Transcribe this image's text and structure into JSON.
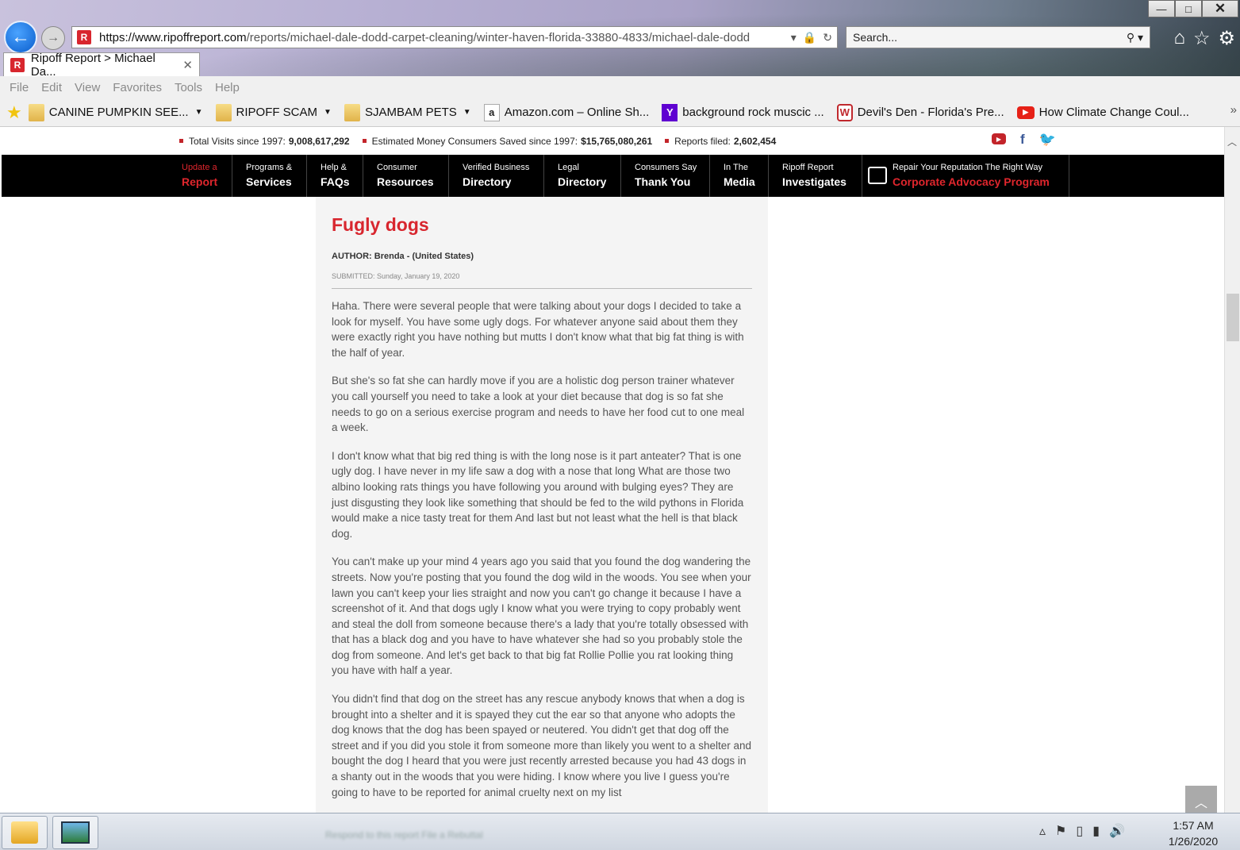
{
  "browser": {
    "url_host": "https://www.ripoffreport.com",
    "url_path": "/reports/michael-dale-dodd-carpet-cleaning/winter-haven-florida-33880-4833/michael-dale-dodd",
    "search_placeholder": "Search...",
    "tab_title": "Ripoff Report > Michael Da...",
    "window_buttons": {
      "minimize": "—",
      "maximize": "□",
      "close": "✕"
    }
  },
  "menu": [
    "File",
    "Edit",
    "View",
    "Favorites",
    "Tools",
    "Help"
  ],
  "favorites": [
    {
      "label": "CANINE PUMPKIN SEE...",
      "icon": "folder-icon",
      "dropdown": true
    },
    {
      "label": "RIPOFF SCAM",
      "icon": "folder-icon",
      "dropdown": true
    },
    {
      "label": "SJAMBAM PETS",
      "icon": "folder-icon",
      "dropdown": true
    },
    {
      "label": "Amazon.com – Online Sh...",
      "icon": "amazon-icon",
      "dropdown": false
    },
    {
      "label": "background rock muscic ...",
      "icon": "yahoo-icon",
      "dropdown": false
    },
    {
      "label": "Devil's Den - Florida's Pre...",
      "icon": "devils-den-icon",
      "dropdown": false
    },
    {
      "label": "How Climate Change Coul...",
      "icon": "youtube-icon",
      "dropdown": false
    }
  ],
  "stats": [
    {
      "label": "Total Visits since 1997:",
      "value": "9,008,617,292"
    },
    {
      "label": "Estimated Money Consumers Saved since 1997:",
      "value": "$15,765,080,261"
    },
    {
      "label": "Reports filed:",
      "value": "2,602,454"
    }
  ],
  "nav": [
    {
      "small": "Update a",
      "big": "Report",
      "red": true
    },
    {
      "small": "Programs &",
      "big": "Services",
      "red": false
    },
    {
      "small": "Help &",
      "big": "FAQs",
      "red": false
    },
    {
      "small": "Consumer",
      "big": "Resources",
      "red": false
    },
    {
      "small": "Verified Business",
      "big": "Directory",
      "red": false
    },
    {
      "small": "Legal",
      "big": "Directory",
      "red": false
    },
    {
      "small": "Consumers Say",
      "big": "Thank You",
      "red": false
    },
    {
      "small": "In The",
      "big": "Media",
      "red": false
    },
    {
      "small": "Ripoff Report",
      "big": "Investigates",
      "red": false
    },
    {
      "small": "Repair Your Reputation The Right Way",
      "big": "Corporate Advocacy Program",
      "red": true
    }
  ],
  "article": {
    "title": "Fugly dogs",
    "author": "AUTHOR: Brenda - (United States)",
    "submitted": "SUBMITTED: Sunday, January 19, 2020",
    "paragraphs": [
      " Haha. There were several people that were talking about your dogs I decided to take a look for myself. You have some ugly dogs. For whatever anyone said about them they were exactly right you have nothing but mutts I don't know what that big fat thing is with the half of year.",
      "But she's so fat she can hardly move if you are a holistic dog person trainer whatever you call yourself you need to take a look at your diet because that dog is so fat she needs to go on a serious exercise program and needs to have her food cut to one meal a week.",
      "I don't know what that big red thing is with the long nose is it part anteater? That is one ugly dog. I have never in my life saw a dog with a nose that long What are those two albino looking rats things you have following you around with bulging eyes? They are just disgusting they look like something that should be fed to the wild pythons in Florida would make a nice tasty treat for them And last but not least what the hell is that black dog.",
      "You can't make up your mind 4 years ago you said that you found the dog wandering the streets. Now you're posting that you found the dog wild in the woods. You see when your lawn you can't keep your lies straight and now you can't go change it because I have a screenshot of it. And that dogs ugly I know what you were trying to copy probably went and steal the doll from someone because there's a lady that you're totally obsessed with that has a black dog and you have to have whatever she had so you probably stole the dog from someone. And let's get back to that big fat Rollie Pollie you rat looking thing you have with half a year.",
      "You didn't find that dog on the street has any rescue anybody knows that when a dog is brought into a shelter and it is spayed they cut the ear so that anyone who adopts the dog knows that the dog has been spayed or neutered. You didn't get that dog off the street and if you did you stole it from someone more than likely you went to a shelter and bought the dog I heard that you were just recently arrested because you had 43 dogs in a shanty out in the woods that you were hiding. I know where you live I guess you're going to have to be reported for animal cruelty next on my list"
    ]
  },
  "taskbar": {
    "ghost_text": "Respond to this report   File a Rebuttal",
    "time": "1:57 AM",
    "date": "1/26/2020"
  },
  "colors": {
    "brand_red": "#d8262e",
    "nav_bg": "#000000"
  }
}
